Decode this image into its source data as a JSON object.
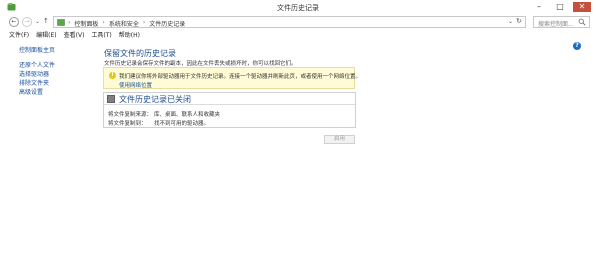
{
  "window": {
    "title": "文件历史记录",
    "minimize": "–",
    "maximize": "□",
    "close": "✕"
  },
  "address_bar": {
    "back": "←",
    "forward": "→",
    "recent": "⌄",
    "up": "↑",
    "crumbs": [
      "控制面板",
      "系统和安全",
      "文件历史记录"
    ],
    "separator": "›",
    "dropdown": "⌄",
    "refresh": "↻",
    "search_placeholder": "搜索控制面..."
  },
  "menu": [
    "文件(F)",
    "编辑(E)",
    "查看(V)",
    "工具(T)",
    "帮助(H)"
  ],
  "sidebar": {
    "home": "控制面板主页",
    "links": [
      "还原个人文件",
      "选择驱动器",
      "排除文件夹",
      "高级设置"
    ]
  },
  "main": {
    "heading": "保留文件的历史记录",
    "description": "文件历史记录会保存文件的副本，因此在文件丢失或损坏时，你可以找回它们。",
    "info": {
      "icon": "i",
      "text": "我们建议你将外部驱动器用于文件历史记录。连接一个驱动器并刷新此页，或者使用一个网络位置。",
      "link": "使用网络位置"
    },
    "status": {
      "title": "文件历史记录已关闭",
      "copy_from_label": "将文件复制来源：",
      "copy_from_value": "库、桌面、联系人和收藏夹",
      "copy_to_label": "将文件复制到：",
      "copy_to_value": "找不到可用的驱动器。"
    },
    "enable_button": "启用"
  },
  "colors": {
    "accent_link": "#1a4fa0",
    "heading": "#1e4c8f",
    "close_button": "#c7503d",
    "info_background": "#fefbd6",
    "help_icon": "#1b6ac8"
  },
  "icons": {
    "app": "file-history-icon",
    "help": "help-icon",
    "search": "search-icon",
    "info": "info-icon",
    "status": "drive-off-icon"
  }
}
